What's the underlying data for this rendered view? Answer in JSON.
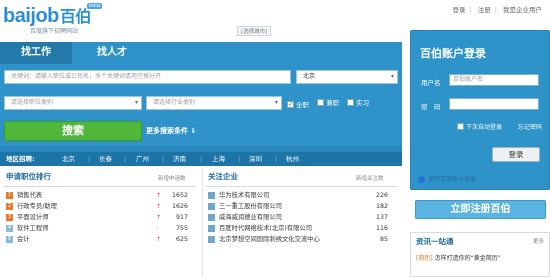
{
  "header": {
    "logo_text": "baijob",
    "logo_cn": "百伯",
    "beta": "beta",
    "slogan": "百度旗下招聘网站",
    "city_select": "[选择城市]",
    "links": [
      "登录",
      "注册",
      "我是企业用户"
    ]
  },
  "tabs": [
    "找工作",
    "找人才"
  ],
  "search": {
    "keyword_placeholder": "关键词：请输入职位或公司名，多个关键词请用空格分开",
    "city_value": "北京",
    "job_category_placeholder": "请选择职位类别",
    "industry_placeholder": "请选择行业类别",
    "options": [
      {
        "label": "全职",
        "checked": true
      },
      {
        "label": "兼职",
        "checked": false
      },
      {
        "label": "实习",
        "checked": false
      }
    ],
    "submit_label": "搜索",
    "more_conditions": "更多搜索条件"
  },
  "regions": {
    "label": "地区招聘:",
    "cities": [
      "北京",
      "长春",
      "广州",
      "济南",
      "上海",
      "深圳",
      "杭州"
    ]
  },
  "hot_jobs": {
    "title": "申请职位排行",
    "column_label": "新增申请数",
    "rows": [
      {
        "rank": "1",
        "name": "销售代表",
        "trend": "↑",
        "count": "1652"
      },
      {
        "rank": "2",
        "name": "行政专员/助理",
        "trend": "↑",
        "count": "1626"
      },
      {
        "rank": "3",
        "name": "平面设计师",
        "trend": "↑",
        "count": "917"
      },
      {
        "rank": "4",
        "name": "软件工程师",
        "trend": "-",
        "count": "755"
      },
      {
        "rank": "5",
        "name": "会计",
        "trend": "↑",
        "count": "625"
      }
    ]
  },
  "companies": {
    "title": "关注企业",
    "column_label": "新增关注数",
    "rows": [
      {
        "name": "华为技术有限公司",
        "count": "226"
      },
      {
        "name": "三一重工股份有限公司",
        "count": "182"
      },
      {
        "name": "威海威润德业有限公司",
        "count": "137"
      },
      {
        "name": "百度时代网络技术(北京)有限公司",
        "count": "116"
      },
      {
        "name": "北京梦想空间国际刺绣文化交流中心",
        "count": "85"
      }
    ]
  },
  "login": {
    "title": "百伯账户登录",
    "username_label": "用户名",
    "username_placeholder": "百伯账户名",
    "password_label": "密　码",
    "auto_login": "下次自动登录",
    "forgot": "忘记密码",
    "submit": "登录",
    "baidu_login": "使用百度账号登录",
    "register": "立即注册百伯"
  },
  "info": {
    "title": "资讯一站通",
    "more": "更多",
    "item_tag": "[简历]",
    "item_text": "怎样打造你的“黄金简历”"
  },
  "colors": {
    "band": "#2f93c9",
    "search_button": "#4fb83a",
    "accent_text": "#1f6a9c"
  }
}
